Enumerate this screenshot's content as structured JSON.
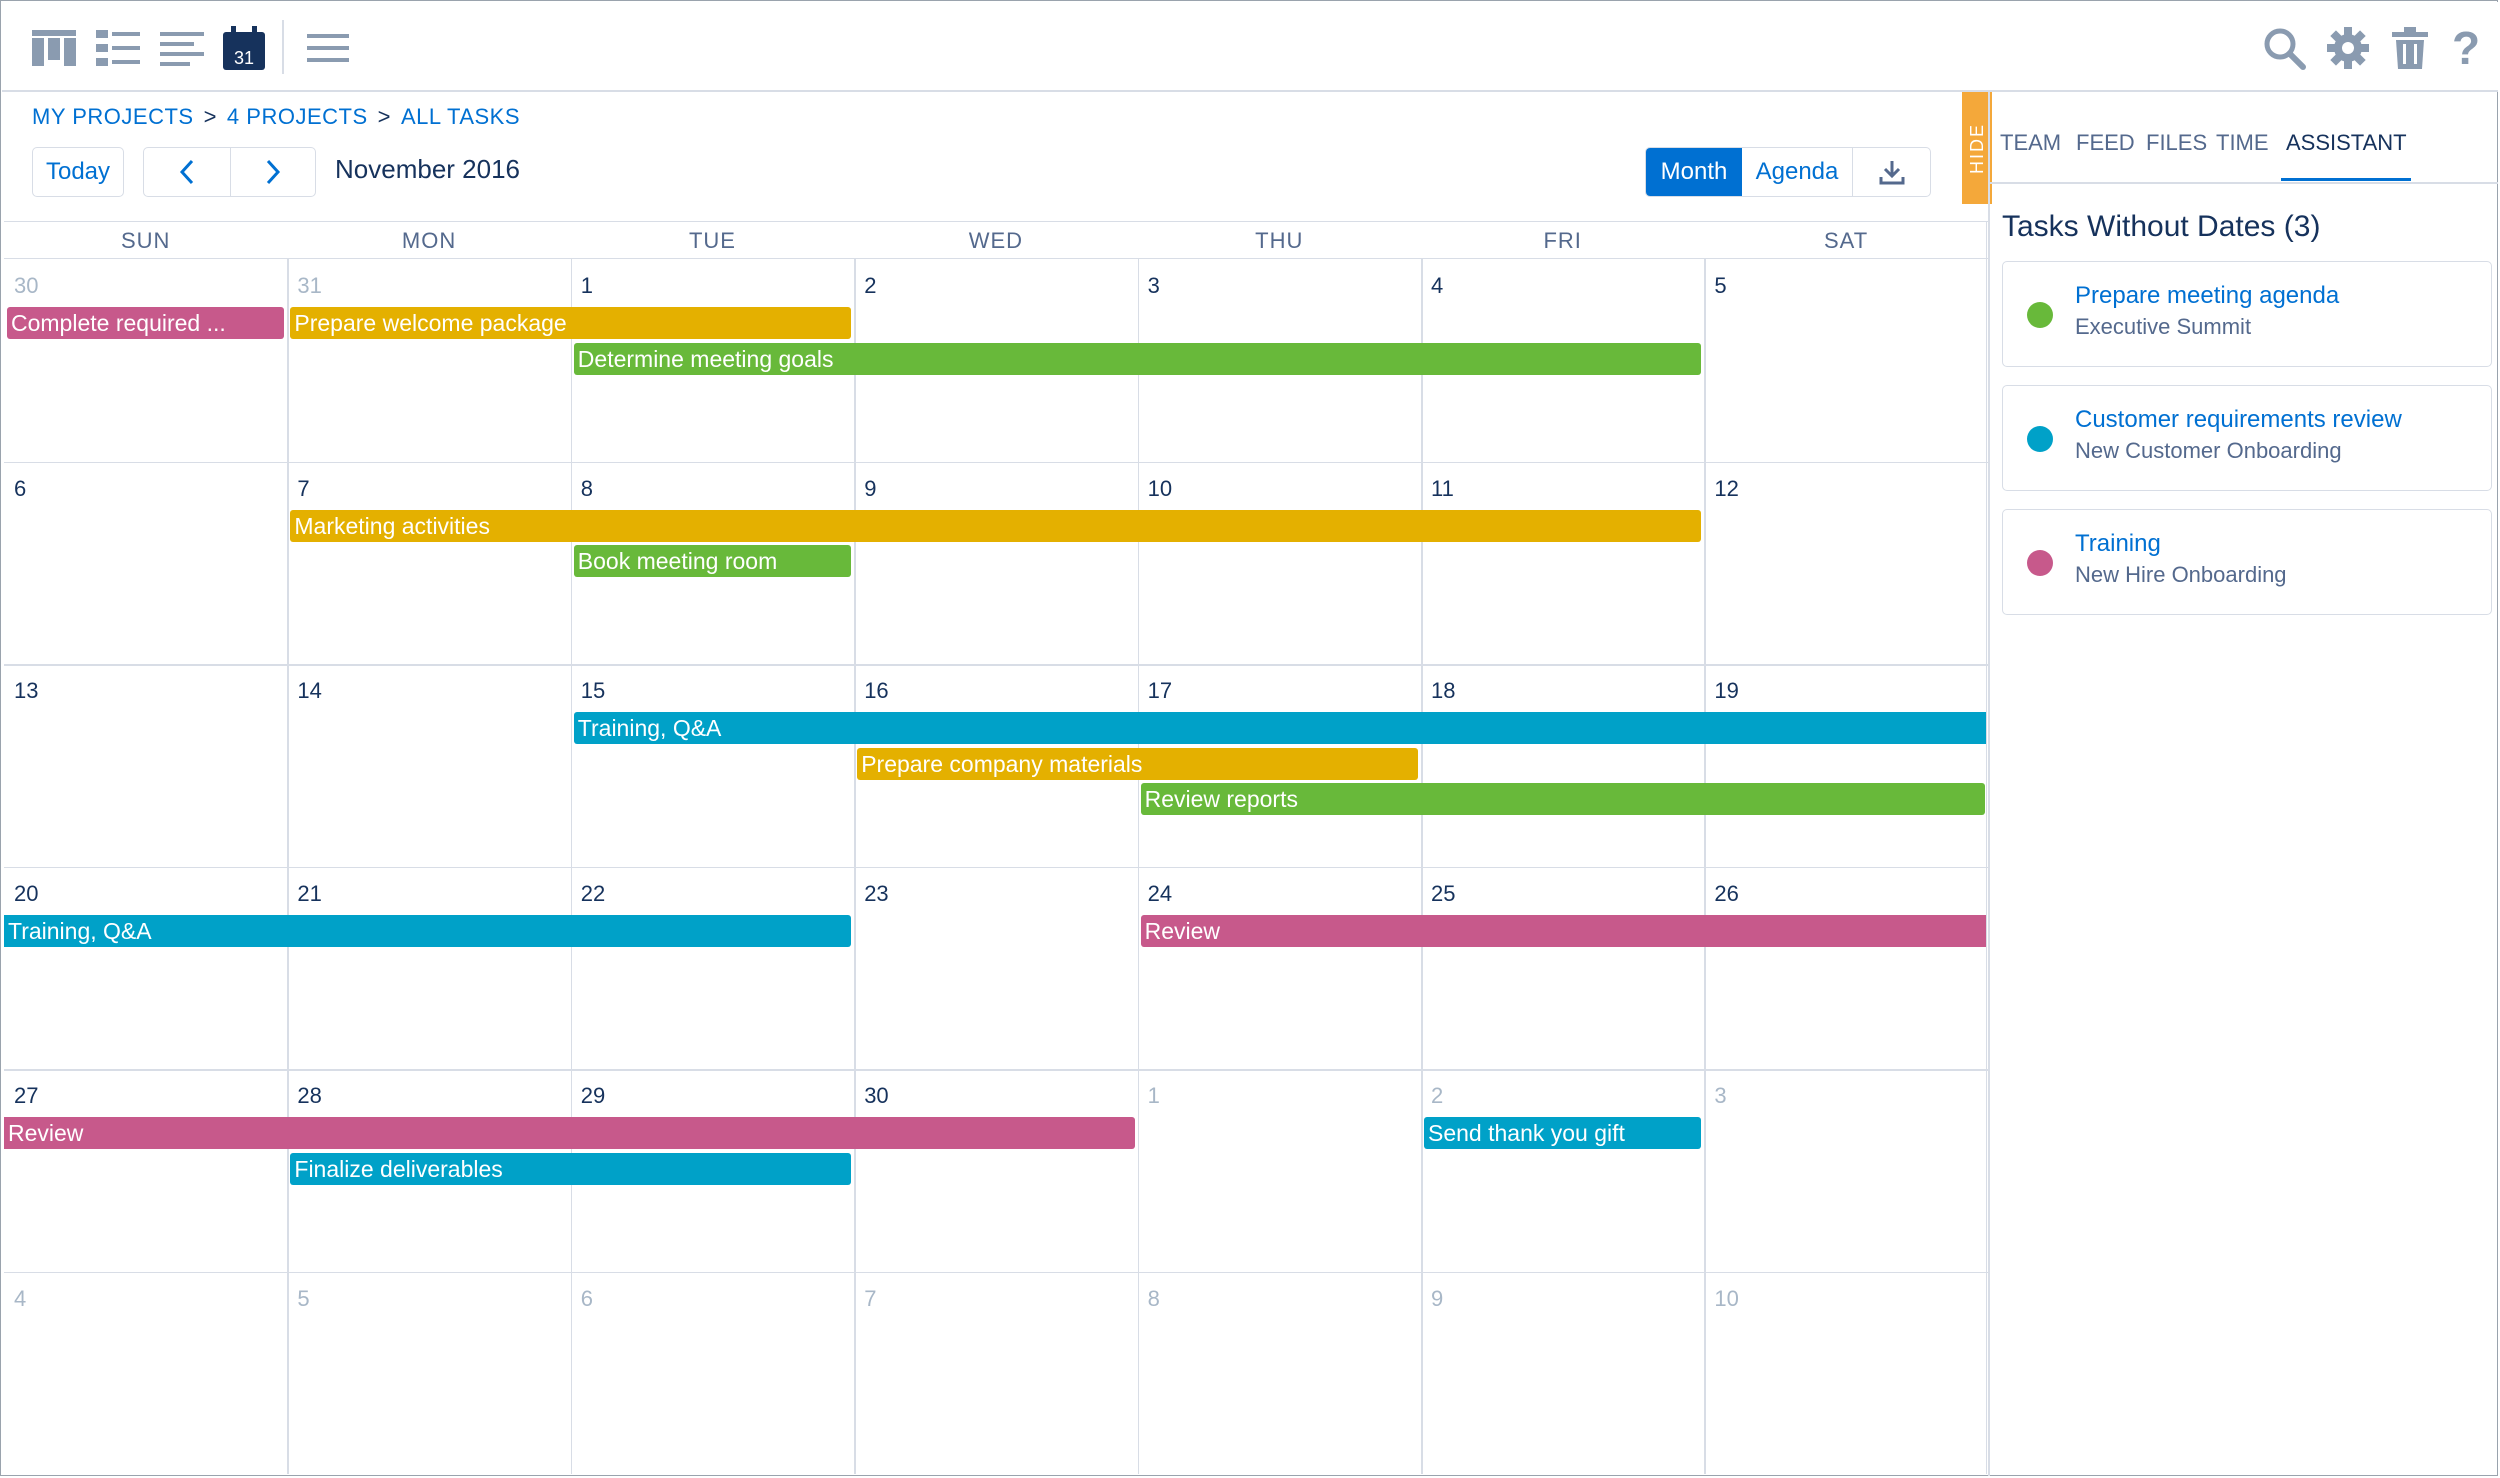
{
  "toolbar": {
    "left_icons": [
      "board-view-icon",
      "list-view-icon",
      "outline-view-icon",
      "calendar-view-icon",
      "menu-icon"
    ],
    "calendar_icon_day": "31",
    "right_icons": [
      "search-icon",
      "gear-icon",
      "trash-icon",
      "help-icon"
    ]
  },
  "breadcrumb": {
    "items": [
      "MY PROJECTS",
      "4 PROJECTS",
      "ALL TASKS"
    ],
    "separator": ">"
  },
  "controls": {
    "today_label": "Today",
    "prev_icon": "chevron-left-icon",
    "next_icon": "chevron-right-icon",
    "current_month": "November 2016",
    "view_month": "Month",
    "view_agenda": "Agenda",
    "download_icon": "download-icon"
  },
  "calendar": {
    "weekdays": [
      "SUN",
      "MON",
      "TUE",
      "WED",
      "THU",
      "FRI",
      "SAT"
    ],
    "weeks": [
      [
        {
          "d": "30",
          "dim": true
        },
        {
          "d": "31",
          "dim": true
        },
        {
          "d": "1"
        },
        {
          "d": "2"
        },
        {
          "d": "3"
        },
        {
          "d": "4"
        },
        {
          "d": "5"
        }
      ],
      [
        {
          "d": "6"
        },
        {
          "d": "7"
        },
        {
          "d": "8"
        },
        {
          "d": "9"
        },
        {
          "d": "10"
        },
        {
          "d": "11"
        },
        {
          "d": "12"
        }
      ],
      [
        {
          "d": "13"
        },
        {
          "d": "14"
        },
        {
          "d": "15"
        },
        {
          "d": "16"
        },
        {
          "d": "17"
        },
        {
          "d": "18"
        },
        {
          "d": "19"
        }
      ],
      [
        {
          "d": "20"
        },
        {
          "d": "21"
        },
        {
          "d": "22"
        },
        {
          "d": "23"
        },
        {
          "d": "24"
        },
        {
          "d": "25"
        },
        {
          "d": "26"
        }
      ],
      [
        {
          "d": "27"
        },
        {
          "d": "28"
        },
        {
          "d": "29"
        },
        {
          "d": "30"
        },
        {
          "d": "1",
          "dim": true
        },
        {
          "d": "2",
          "dim": true
        },
        {
          "d": "3",
          "dim": true
        }
      ],
      [
        {
          "d": "4",
          "dim": true
        },
        {
          "d": "5",
          "dim": true
        },
        {
          "d": "6",
          "dim": true
        },
        {
          "d": "7",
          "dim": true
        },
        {
          "d": "8",
          "dim": true
        },
        {
          "d": "9",
          "dim": true
        },
        {
          "d": "10",
          "dim": true
        }
      ]
    ],
    "colors": {
      "pink": "#c7598b",
      "yellow": "#e4b000",
      "green": "#68b93a",
      "blue": "#00a1c8"
    },
    "events": [
      {
        "title": "Complete required ...",
        "week": 0,
        "lane": 0,
        "start": 0,
        "span": 1,
        "color": "pink"
      },
      {
        "title": "Prepare welcome package",
        "week": 0,
        "lane": 0,
        "start": 1,
        "span": 2,
        "color": "yellow"
      },
      {
        "title": "Determine meeting goals",
        "week": 0,
        "lane": 1,
        "start": 2,
        "span": 4,
        "color": "green"
      },
      {
        "title": "Marketing activities",
        "week": 1,
        "lane": 0,
        "start": 1,
        "span": 5,
        "color": "yellow"
      },
      {
        "title": "Book meeting room",
        "week": 1,
        "lane": 1,
        "start": 2,
        "span": 1,
        "color": "green"
      },
      {
        "title": "Training, Q&A",
        "week": 2,
        "lane": 0,
        "start": 2,
        "span": 5,
        "color": "blue",
        "open_end": true
      },
      {
        "title": "Prepare company materials",
        "week": 2,
        "lane": 1,
        "start": 3,
        "span": 2,
        "color": "yellow"
      },
      {
        "title": "Review reports",
        "week": 2,
        "lane": 2,
        "start": 4,
        "span": 3,
        "color": "green"
      },
      {
        "title": "Training, Q&A",
        "week": 3,
        "lane": 0,
        "start": 0,
        "span": 3,
        "color": "blue",
        "open_start": true
      },
      {
        "title": "Review",
        "week": 3,
        "lane": 0,
        "start": 4,
        "span": 3,
        "color": "pink",
        "open_end": true
      },
      {
        "title": "Review",
        "week": 4,
        "lane": 0,
        "start": 0,
        "span": 4,
        "color": "pink",
        "open_start": true
      },
      {
        "title": "Send thank you gift",
        "week": 4,
        "lane": 0,
        "start": 5,
        "span": 1,
        "color": "blue"
      },
      {
        "title": "Finalize deliverables",
        "week": 4,
        "lane": 1,
        "start": 1,
        "span": 2,
        "color": "blue"
      }
    ]
  },
  "panel": {
    "hide_label": "HIDE",
    "tabs": [
      "TEAM",
      "FEED",
      "FILES",
      "TIME",
      "ASSISTANT"
    ],
    "active_tab": "ASSISTANT",
    "title": "Tasks Without Dates (3)",
    "tasks": [
      {
        "name": "Prepare meeting agenda",
        "project": "Executive Summit",
        "color": "#68b93a"
      },
      {
        "name": "Customer requirements review",
        "project": "New Customer Onboarding",
        "color": "#00a1c8"
      },
      {
        "name": "Training",
        "project": "New Hire Onboarding",
        "color": "#c7598b"
      }
    ]
  }
}
